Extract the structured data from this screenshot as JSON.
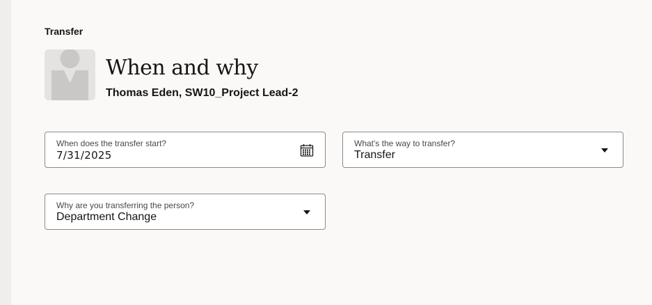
{
  "page": {
    "label": "Transfer",
    "title": "When and why",
    "subtitle": "Thomas Eden, SW10_Project Lead-2"
  },
  "form": {
    "start_date": {
      "label": "When does the transfer start?",
      "value": "7/31/2025",
      "icon": "calendar-icon"
    },
    "way": {
      "label": "What's the way to transfer?",
      "value": "Transfer",
      "icon": "caret-down-icon"
    },
    "reason": {
      "label": "Why are you transferring the person?",
      "value": "Department Change",
      "icon": "caret-down-icon"
    }
  },
  "colors": {
    "background": "#fbf9f8",
    "gutter": "#efeeec",
    "field_border": "#8c8985",
    "avatar_bg": "#e4e3e2",
    "avatar_fg": "#c9c8c6"
  }
}
